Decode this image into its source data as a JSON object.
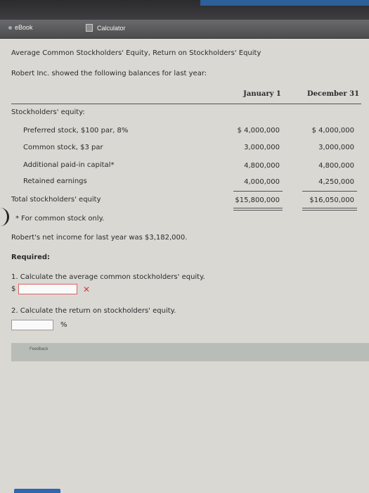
{
  "tabs": {
    "ebook": "eBook",
    "calculator": "Calculator"
  },
  "topbar": {
    "corner": "— — — — —"
  },
  "problem": {
    "title": "Average Common Stockholders' Equity, Return on Stockholders' Equity",
    "intro": "Robert Inc. showed the following balances for last year:"
  },
  "table": {
    "col_jan": "January 1",
    "col_dec": "December 31",
    "section_label": "Stockholders' equity:",
    "rows": [
      {
        "label": "Preferred stock, $100 par, 8%",
        "jan": "$ 4,000,000",
        "dec": "$ 4,000,000"
      },
      {
        "label": "Common stock, $3 par",
        "jan": "3,000,000",
        "dec": "3,000,000"
      },
      {
        "label": "Additional paid-in capital*",
        "jan": "4,800,000",
        "dec": "4,800,000"
      },
      {
        "label": "Retained earnings",
        "jan": "4,000,000",
        "dec": "4,250,000"
      }
    ],
    "total": {
      "label": "Total stockholders' equity",
      "jan": "$15,800,000",
      "dec": "$16,050,000"
    },
    "footnote": "* For common stock only."
  },
  "net_income": "Robert's net income for last year was $3,182,000.",
  "required": "Required:",
  "q1": {
    "text": "1.  Calculate the average common stockholders' equity.",
    "prefix": "$",
    "value": "",
    "status": "✕"
  },
  "q2": {
    "text": "2.  Calculate the return on stockholders' equity.",
    "value": "",
    "suffix": "%"
  },
  "feedback": "Feedback"
}
